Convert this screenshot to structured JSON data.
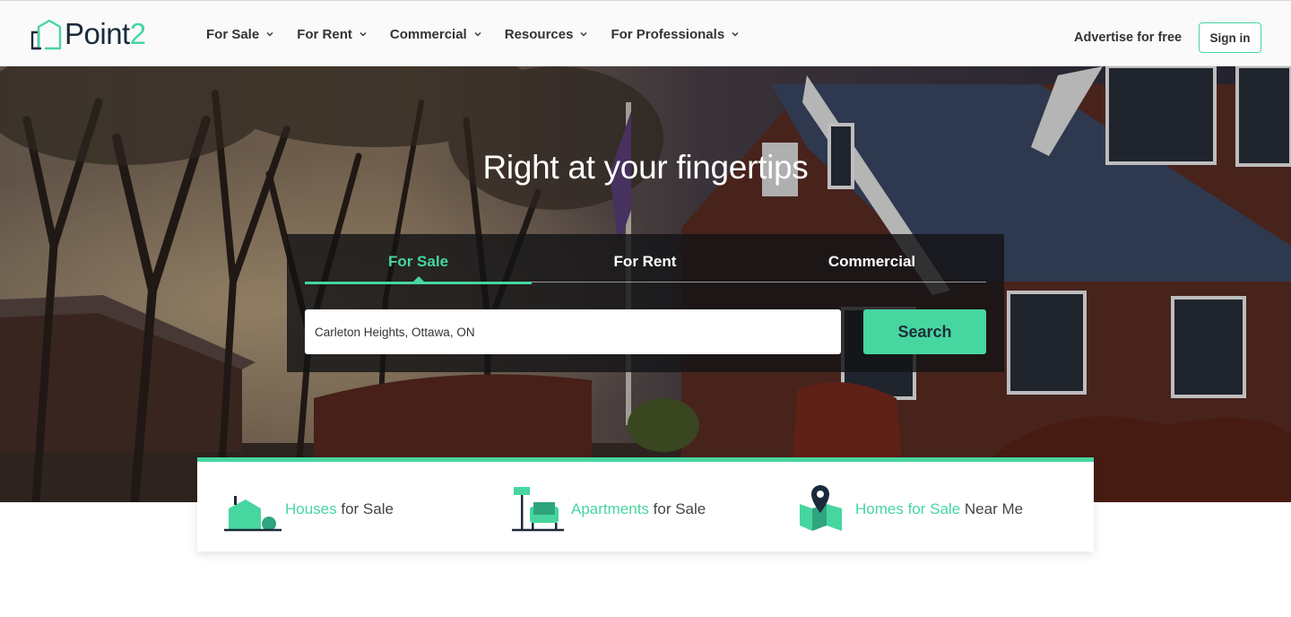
{
  "brand": {
    "name_main": "Point",
    "name_accent": "2"
  },
  "nav": {
    "items": [
      {
        "label": "For Sale"
      },
      {
        "label": "For Rent"
      },
      {
        "label": "Commercial"
      },
      {
        "label": "Resources"
      },
      {
        "label": "For Professionals"
      }
    ],
    "advertise": "Advertise for free",
    "signin": "Sign in"
  },
  "hero": {
    "title": "Right at your fingertips",
    "tabs": [
      {
        "label": "For Sale",
        "active": true
      },
      {
        "label": "For Rent",
        "active": false
      },
      {
        "label": "Commercial",
        "active": false
      }
    ],
    "search": {
      "value": "Carleton Heights, Ottawa, ON",
      "button": "Search"
    }
  },
  "categories": [
    {
      "highlight": "Houses",
      "rest": " for Sale",
      "icon": "house-icon"
    },
    {
      "highlight": "Apartments",
      "rest": " for Sale",
      "icon": "apartment-icon"
    },
    {
      "highlight": "Homes for Sale",
      "rest": " Near Me",
      "icon": "map-pin-icon"
    }
  ],
  "colors": {
    "accent": "#47d6a0",
    "dark": "#1f2d3a"
  }
}
